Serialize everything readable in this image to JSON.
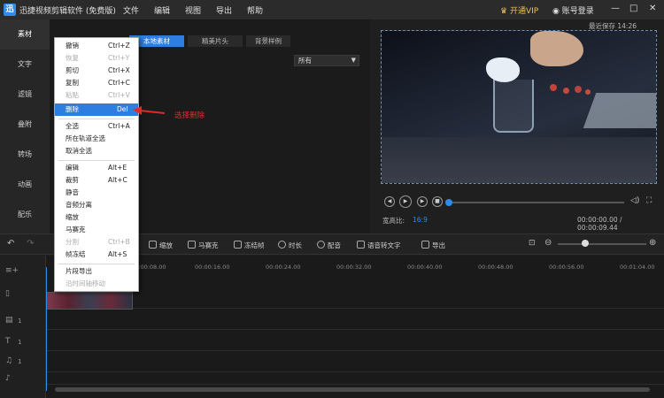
{
  "app": {
    "logo_text": "迅",
    "title": "迅捷视频剪辑软件 (免费版)",
    "menus": [
      "文件",
      "编辑",
      "视图",
      "导出",
      "帮助"
    ],
    "vip": "开通VIP",
    "login": "账号登录",
    "window_controls": [
      "—",
      "□",
      "✕"
    ]
  },
  "sidenav": [
    "素材",
    "文字",
    "滤镜",
    "叠附",
    "转场",
    "动画",
    "配乐"
  ],
  "media": {
    "tabs": [
      "本地素材",
      "精美片头",
      "背景样例"
    ],
    "active_tab": "本地素材",
    "filter_value": "所有"
  },
  "preview": {
    "autosave": "最近保存 14:26",
    "ratio_label": "宽高比:",
    "ratio_value": "16:9",
    "timecode": "00:00:00.00 / 00:00:09.44",
    "progress": 0.0
  },
  "toolbar": {
    "tools": [
      "缩放",
      "马赛克",
      "冻结帧",
      "时长",
      "配音",
      "语音转文字",
      "导出"
    ]
  },
  "timeline": {
    "ruler": [
      "00:00:08.00",
      "00:00:16.00",
      "00:00:24.00",
      "00:00:32.00",
      "00:00:40.00",
      "00:00:48.00",
      "00:00:56.00",
      "00:01:04.00"
    ],
    "track_labels": [
      "1",
      "1",
      "1"
    ]
  },
  "context_menu": {
    "items": [
      {
        "label": "撤销",
        "shortcut": "Ctrl+Z",
        "disabled": false
      },
      {
        "label": "恢复",
        "shortcut": "Ctrl+Y",
        "disabled": true
      },
      {
        "label": "剪切",
        "shortcut": "Ctrl+X",
        "disabled": false
      },
      {
        "label": "复制",
        "shortcut": "Ctrl+C",
        "disabled": false
      },
      {
        "label": "粘贴",
        "shortcut": "Ctrl+V",
        "disabled": true
      },
      {
        "label": "删除",
        "shortcut": "Del",
        "disabled": false,
        "highlighted": true
      },
      {
        "label": "全选",
        "shortcut": "Ctrl+A",
        "disabled": false
      },
      {
        "label": "所在轨道全选",
        "shortcut": "",
        "disabled": false
      },
      {
        "label": "取消全选",
        "shortcut": "",
        "disabled": false
      },
      {
        "label": "编辑",
        "shortcut": "Alt+E",
        "disabled": false
      },
      {
        "label": "裁剪",
        "shortcut": "Alt+C",
        "disabled": false
      },
      {
        "label": "静音",
        "shortcut": "",
        "disabled": false
      },
      {
        "label": "音频分离",
        "shortcut": "",
        "disabled": false
      },
      {
        "label": "缩放",
        "shortcut": "",
        "disabled": false
      },
      {
        "label": "马赛克",
        "shortcut": "",
        "disabled": false
      },
      {
        "label": "分割",
        "shortcut": "Ctrl+B",
        "disabled": true
      },
      {
        "label": "帧冻结",
        "shortcut": "Alt+S",
        "disabled": false
      },
      {
        "label": "片段导出",
        "shortcut": "",
        "disabled": false
      },
      {
        "label": "沿时间轴移动",
        "shortcut": "",
        "disabled": true
      }
    ]
  },
  "annotation": {
    "text": "选择删除",
    "color": "#e02a2a"
  },
  "colors": {
    "accent": "#2d8ceb",
    "menu_highlight": "#2d7ee0",
    "vip": "#f0c05a"
  }
}
